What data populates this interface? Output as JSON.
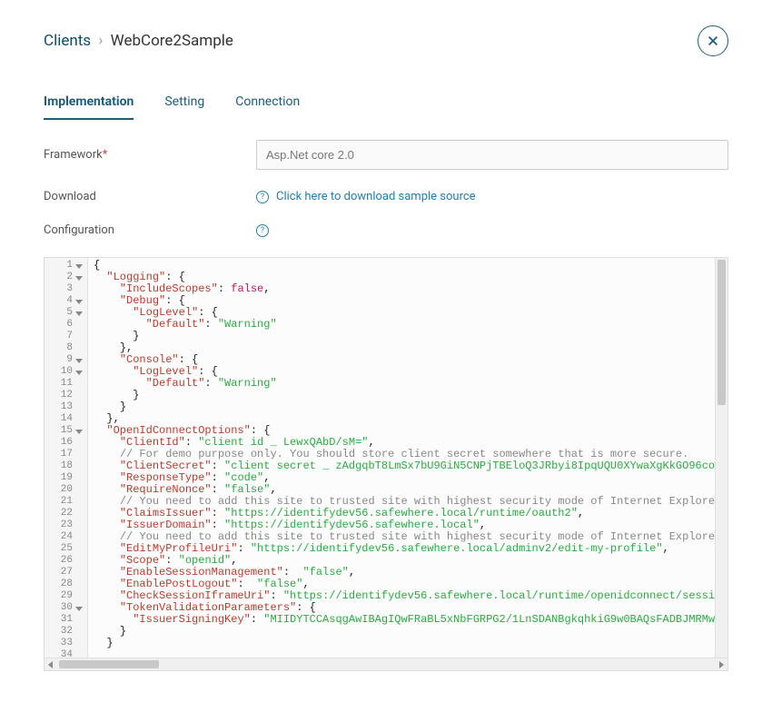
{
  "breadcrumb": {
    "parent": "Clients",
    "sep": "›",
    "current": "WebCore2Sample"
  },
  "tabs": [
    {
      "label": "Implementation",
      "active": true
    },
    {
      "label": "Setting",
      "active": false
    },
    {
      "label": "Connection",
      "active": false
    }
  ],
  "form": {
    "framework_label": "Framework",
    "required_mark": "*",
    "framework_value": "Asp.Net core 2.0",
    "download_label": "Download",
    "download_link": "Click here to download sample source",
    "config_label": "Configuration"
  },
  "code_lines": [
    {
      "n": 1,
      "fold": true,
      "indent": 0,
      "tokens": [
        {
          "t": "punc",
          "v": "{"
        }
      ]
    },
    {
      "n": 2,
      "fold": true,
      "indent": 1,
      "tokens": [
        {
          "t": "key",
          "v": "\"Logging\""
        },
        {
          "t": "punc",
          "v": ": {"
        }
      ]
    },
    {
      "n": 3,
      "fold": false,
      "indent": 2,
      "tokens": [
        {
          "t": "key",
          "v": "\"IncludeScopes\""
        },
        {
          "t": "punc",
          "v": ": "
        },
        {
          "t": "bool",
          "v": "false"
        },
        {
          "t": "punc",
          "v": ","
        }
      ]
    },
    {
      "n": 4,
      "fold": true,
      "indent": 2,
      "tokens": [
        {
          "t": "key",
          "v": "\"Debug\""
        },
        {
          "t": "punc",
          "v": ": {"
        }
      ]
    },
    {
      "n": 5,
      "fold": true,
      "indent": 3,
      "tokens": [
        {
          "t": "key",
          "v": "\"LogLevel\""
        },
        {
          "t": "punc",
          "v": ": {"
        }
      ]
    },
    {
      "n": 6,
      "fold": false,
      "indent": 4,
      "tokens": [
        {
          "t": "key",
          "v": "\"Default\""
        },
        {
          "t": "punc",
          "v": ": "
        },
        {
          "t": "str",
          "v": "\"Warning\""
        }
      ]
    },
    {
      "n": 7,
      "fold": false,
      "indent": 3,
      "tokens": [
        {
          "t": "punc",
          "v": "}"
        }
      ]
    },
    {
      "n": 8,
      "fold": false,
      "indent": 2,
      "tokens": [
        {
          "t": "punc",
          "v": "},"
        }
      ]
    },
    {
      "n": 9,
      "fold": true,
      "indent": 2,
      "tokens": [
        {
          "t": "key",
          "v": "\"Console\""
        },
        {
          "t": "punc",
          "v": ": {"
        }
      ]
    },
    {
      "n": 10,
      "fold": true,
      "indent": 3,
      "tokens": [
        {
          "t": "key",
          "v": "\"LogLevel\""
        },
        {
          "t": "punc",
          "v": ": {"
        }
      ]
    },
    {
      "n": 11,
      "fold": false,
      "indent": 4,
      "tokens": [
        {
          "t": "key",
          "v": "\"Default\""
        },
        {
          "t": "punc",
          "v": ": "
        },
        {
          "t": "str",
          "v": "\"Warning\""
        }
      ]
    },
    {
      "n": 12,
      "fold": false,
      "indent": 3,
      "tokens": [
        {
          "t": "punc",
          "v": "}"
        }
      ]
    },
    {
      "n": 13,
      "fold": false,
      "indent": 2,
      "tokens": [
        {
          "t": "punc",
          "v": "}"
        }
      ]
    },
    {
      "n": 14,
      "fold": false,
      "indent": 1,
      "tokens": [
        {
          "t": "punc",
          "v": "},"
        }
      ]
    },
    {
      "n": 15,
      "fold": true,
      "indent": 1,
      "tokens": [
        {
          "t": "key",
          "v": "\"OpenIdConnectOptions\""
        },
        {
          "t": "punc",
          "v": ": {"
        }
      ]
    },
    {
      "n": 16,
      "fold": false,
      "indent": 2,
      "tokens": [
        {
          "t": "key",
          "v": "\"ClientId\""
        },
        {
          "t": "punc",
          "v": ": "
        },
        {
          "t": "str",
          "v": "\"client id _ LewxQAbD/sM=\""
        },
        {
          "t": "punc",
          "v": ","
        }
      ]
    },
    {
      "n": 17,
      "fold": false,
      "indent": 2,
      "tokens": [
        {
          "t": "com",
          "v": "// For demo purpose only. You should store client secret somewhere that is more secure."
        }
      ]
    },
    {
      "n": 18,
      "fold": false,
      "indent": 2,
      "tokens": [
        {
          "t": "key",
          "v": "\"ClientSecret\""
        },
        {
          "t": "punc",
          "v": ": "
        },
        {
          "t": "str",
          "v": "\"client secret _ zAdgqbT8LmSx7bU9GiN5CNPjTBEloQ3JRbyi8IpqUQU0XYwaXgKkGO96co"
        }
      ]
    },
    {
      "n": 19,
      "fold": false,
      "indent": 2,
      "tokens": [
        {
          "t": "key",
          "v": "\"ResponseType\""
        },
        {
          "t": "punc",
          "v": ": "
        },
        {
          "t": "str",
          "v": "\"code\""
        },
        {
          "t": "punc",
          "v": ","
        }
      ]
    },
    {
      "n": 20,
      "fold": false,
      "indent": 2,
      "tokens": [
        {
          "t": "key",
          "v": "\"RequireNonce\""
        },
        {
          "t": "punc",
          "v": ": "
        },
        {
          "t": "str",
          "v": "\"false\""
        },
        {
          "t": "punc",
          "v": ","
        }
      ]
    },
    {
      "n": 21,
      "fold": false,
      "indent": 2,
      "tokens": [
        {
          "t": "com",
          "v": "// You need to add this site to trusted site with highest security mode of Internet Explore"
        }
      ]
    },
    {
      "n": 22,
      "fold": false,
      "indent": 2,
      "tokens": [
        {
          "t": "key",
          "v": "\"ClaimsIssuer\""
        },
        {
          "t": "punc",
          "v": ": "
        },
        {
          "t": "str",
          "v": "\"https://identifydev56.safewhere.local/runtime/oauth2\""
        },
        {
          "t": "punc",
          "v": ","
        }
      ]
    },
    {
      "n": 23,
      "fold": false,
      "indent": 2,
      "tokens": [
        {
          "t": "key",
          "v": "\"IssuerDomain\""
        },
        {
          "t": "punc",
          "v": ": "
        },
        {
          "t": "str",
          "v": "\"https://identifydev56.safewhere.local\""
        },
        {
          "t": "punc",
          "v": ","
        }
      ]
    },
    {
      "n": 24,
      "fold": false,
      "indent": 2,
      "tokens": [
        {
          "t": "com",
          "v": "// You need to add this site to trusted site with highest security mode of Internet Explore"
        }
      ]
    },
    {
      "n": 25,
      "fold": false,
      "indent": 2,
      "tokens": [
        {
          "t": "key",
          "v": "\"EditMyProfileUri\""
        },
        {
          "t": "punc",
          "v": ": "
        },
        {
          "t": "str",
          "v": "\"https://identifydev56.safewhere.local/adminv2/edit-my-profile\""
        },
        {
          "t": "punc",
          "v": ","
        }
      ]
    },
    {
      "n": 26,
      "fold": false,
      "indent": 2,
      "tokens": [
        {
          "t": "key",
          "v": "\"Scope\""
        },
        {
          "t": "punc",
          "v": ": "
        },
        {
          "t": "str",
          "v": "\"openid\""
        },
        {
          "t": "punc",
          "v": ","
        }
      ]
    },
    {
      "n": 27,
      "fold": false,
      "indent": 2,
      "tokens": [
        {
          "t": "key",
          "v": "\"EnableSessionManagement\""
        },
        {
          "t": "punc",
          "v": ":  "
        },
        {
          "t": "str",
          "v": "\"false\""
        },
        {
          "t": "punc",
          "v": ","
        }
      ]
    },
    {
      "n": 28,
      "fold": false,
      "indent": 2,
      "tokens": [
        {
          "t": "key",
          "v": "\"EnablePostLogout\""
        },
        {
          "t": "punc",
          "v": ":  "
        },
        {
          "t": "str",
          "v": "\"false\""
        },
        {
          "t": "punc",
          "v": ","
        }
      ]
    },
    {
      "n": 29,
      "fold": false,
      "indent": 2,
      "tokens": [
        {
          "t": "key",
          "v": "\"CheckSessionIframeUri\""
        },
        {
          "t": "punc",
          "v": ": "
        },
        {
          "t": "str",
          "v": "\"https://identifydev56.safewhere.local/runtime/openidconnect/sessi"
        }
      ]
    },
    {
      "n": 30,
      "fold": true,
      "indent": 2,
      "tokens": [
        {
          "t": "key",
          "v": "\"TokenValidationParameters\""
        },
        {
          "t": "punc",
          "v": ": {"
        }
      ]
    },
    {
      "n": 31,
      "fold": false,
      "indent": 3,
      "tokens": [
        {
          "t": "key",
          "v": "\"IssuerSigningKey\""
        },
        {
          "t": "punc",
          "v": ": "
        },
        {
          "t": "str",
          "v": "\"MIIDYTCCAsqgAwIBAgIQwFRaBL5xNbFGRPG2/1LnSDANBgkqhkiG9w0BAQsFADBJMRMw"
        }
      ]
    },
    {
      "n": 32,
      "fold": false,
      "indent": 2,
      "tokens": [
        {
          "t": "punc",
          "v": "}"
        }
      ]
    },
    {
      "n": 33,
      "fold": false,
      "indent": 1,
      "tokens": [
        {
          "t": "punc",
          "v": "}"
        }
      ]
    },
    {
      "n": 34,
      "fold": false,
      "indent": 0,
      "tokens": []
    }
  ]
}
